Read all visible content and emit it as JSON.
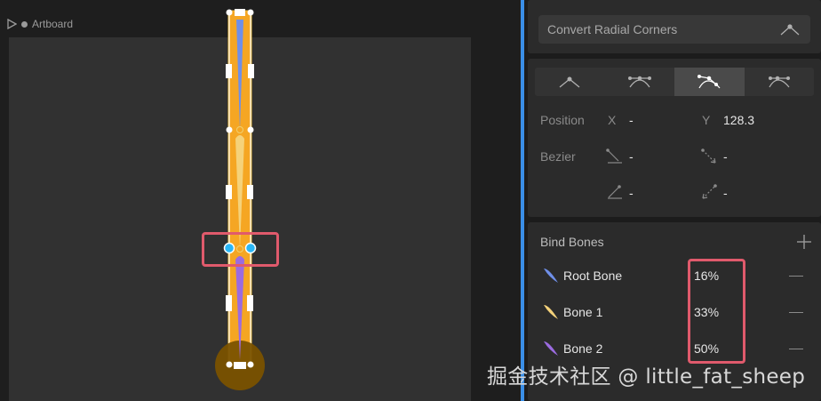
{
  "artboard": {
    "label": "Artboard"
  },
  "panel": {
    "convert_label": "Convert Radial Corners",
    "position": {
      "label": "Position",
      "x_label": "X",
      "x_value": "-",
      "y_label": "Y",
      "y_value": "128.3"
    },
    "bezier": {
      "label": "Bezier",
      "in_x": "-",
      "in_y": "-",
      "out_x": "-",
      "out_y": "-"
    },
    "bind_bones": {
      "title": "Bind Bones",
      "bones": [
        {
          "name": "Root Bone",
          "weight": "16%",
          "color": "#6f8fe8"
        },
        {
          "name": "Bone 1",
          "weight": "33%",
          "color": "#f5d27a"
        },
        {
          "name": "Bone 2",
          "weight": "50%",
          "color": "#9b6be0"
        }
      ]
    }
  },
  "watermark": "掘金技术社区 @ little_fat_sheep",
  "colors": {
    "accent": "#3a8fe8",
    "highlight": "#e05a6c",
    "bone_fill": "#f5a623"
  }
}
